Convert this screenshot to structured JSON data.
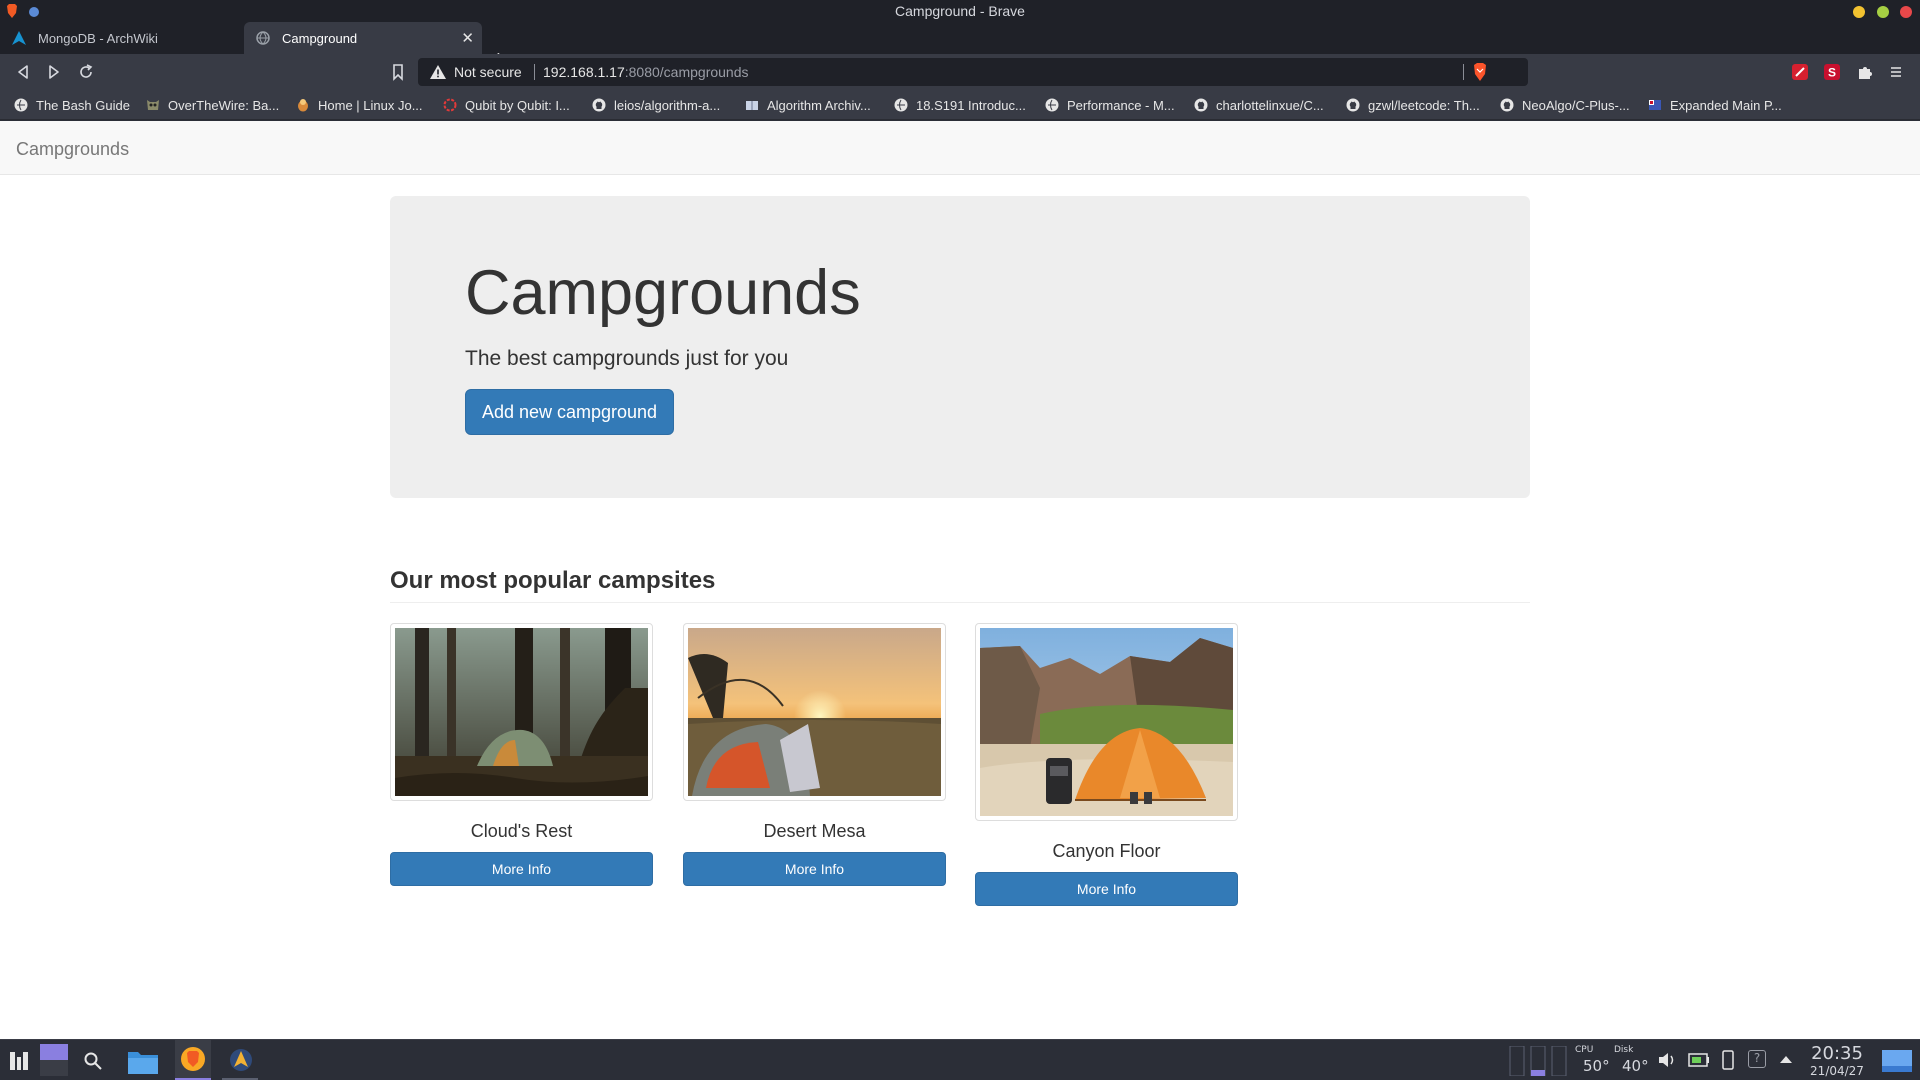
{
  "window": {
    "title": "Campground - Brave"
  },
  "tabs": [
    {
      "label": "MongoDB - ArchWiki",
      "icon": "arch-linux-icon",
      "active": false
    },
    {
      "label": "Campground",
      "icon": "globe-icon",
      "active": true
    }
  ],
  "address": {
    "security_label": "Not secure",
    "host": "192.168.1.17",
    "path": ":8080/campgrounds"
  },
  "bookmarks": [
    {
      "label": "The Bash Guide",
      "icon": "globe-icon"
    },
    {
      "label": "OverTheWire: Ba...",
      "icon": "owl-icon"
    },
    {
      "label": "Home | Linux Jo...",
      "icon": "penguin-icon"
    },
    {
      "label": "Qubit by Qubit: I...",
      "icon": "qubit-icon"
    },
    {
      "label": "leios/algorithm-a...",
      "icon": "github-icon"
    },
    {
      "label": "Algorithm Archiv...",
      "icon": "book-icon"
    },
    {
      "label": "18.S191 Introduc...",
      "icon": "globe-icon"
    },
    {
      "label": "Performance - M...",
      "icon": "globe-icon"
    },
    {
      "label": "charlottelinxue/C...",
      "icon": "github-icon"
    },
    {
      "label": "gzwl/leetcode: Th...",
      "icon": "github-icon"
    },
    {
      "label": "NeoAlgo/C-Plus-...",
      "icon": "github-icon"
    },
    {
      "label": "Expanded Main P...",
      "icon": "flag-icon"
    }
  ],
  "site": {
    "brand": "Campgrounds",
    "heading": "Campgrounds",
    "tagline": "The best campgrounds just for you",
    "add_button": "Add new campground",
    "section_title": "Our most popular campsites",
    "campgrounds": [
      {
        "name": "Cloud's Rest",
        "button": "More Info"
      },
      {
        "name": "Desert Mesa",
        "button": "More Info"
      },
      {
        "name": "Canyon Floor",
        "button": "More Info"
      }
    ]
  },
  "taskbar": {
    "cpu_label": "CPU",
    "cpu_temp": "50°",
    "disk_label": "Disk",
    "disk_temp": "40°",
    "battery_help": "?",
    "time": "20:35",
    "date": "21/04/27"
  },
  "colors": {
    "primary": "#337ab7",
    "jumbotron_bg": "#eeeeee",
    "browser_chrome": "#383b45"
  }
}
